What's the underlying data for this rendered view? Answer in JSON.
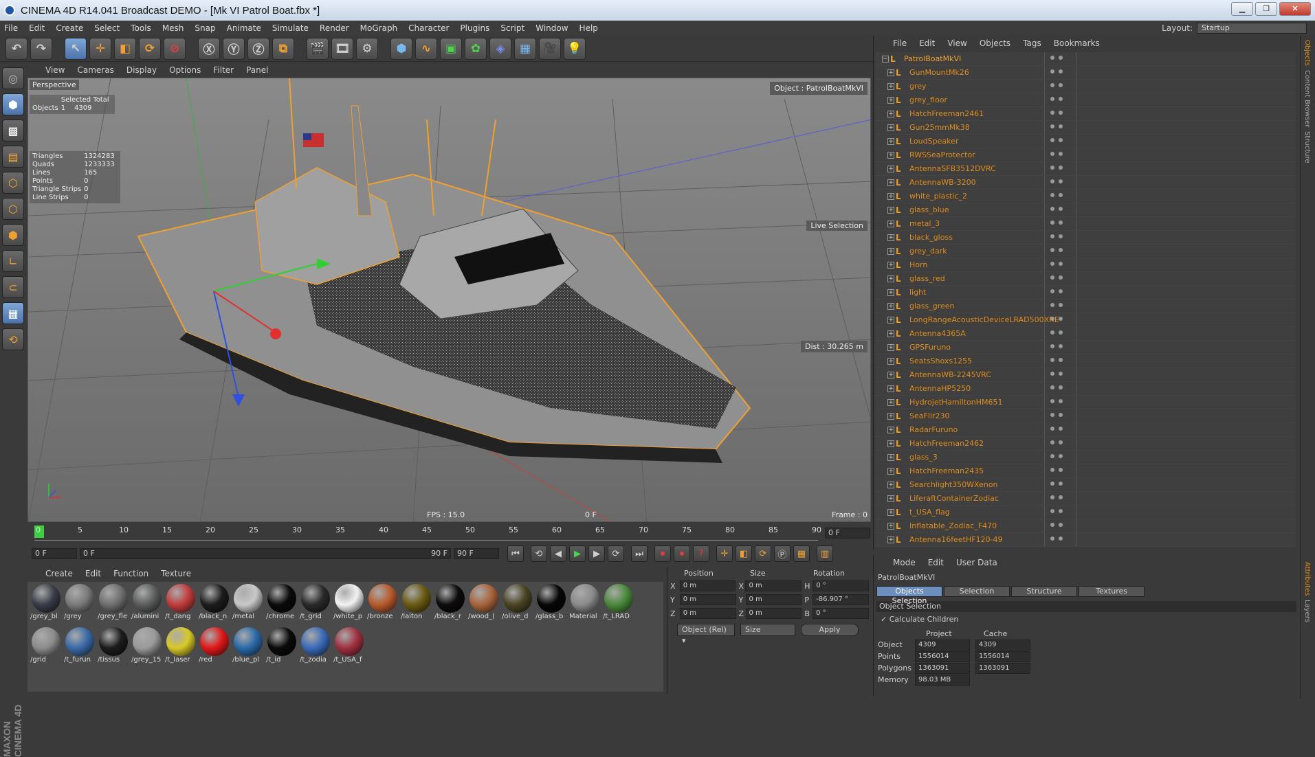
{
  "window": {
    "title": "CINEMA 4D R14.041 Broadcast DEMO - [Mk VI Patrol Boat.fbx *]",
    "min": "▁",
    "max": "❐",
    "close": "✕"
  },
  "menu": [
    "File",
    "Edit",
    "Create",
    "Select",
    "Tools",
    "Mesh",
    "Snap",
    "Animate",
    "Simulate",
    "Render",
    "MoGraph",
    "Character",
    "Plugins",
    "Script",
    "Window",
    "Help"
  ],
  "layout": {
    "label": "Layout:",
    "value": "Startup"
  },
  "viewport": {
    "menu": [
      "View",
      "Cameras",
      "Display",
      "Options",
      "Filter",
      "Panel"
    ],
    "label": "Perspective",
    "selected_header": "Selected Total",
    "objects_label": "Objects",
    "objects_sel": "1",
    "objects_total": "4309",
    "stats": [
      [
        "Triangles",
        "1324283"
      ],
      [
        "Quads",
        "1233333"
      ],
      [
        "Lines",
        "165"
      ],
      [
        "Points",
        "0"
      ],
      [
        "Triangle Strips",
        "0"
      ],
      [
        "Line Strips",
        "0"
      ]
    ],
    "object_label": "Object : PatrolBoatMkVI",
    "live_selection": "Live Selection",
    "dist": "Dist : 30.265 m",
    "fps": "FPS : 15.0",
    "frame_mid": "0 F",
    "frame_right": "Frame : 0"
  },
  "timeline": {
    "ticks": [
      "0",
      "5",
      "10",
      "15",
      "20",
      "25",
      "30",
      "35",
      "40",
      "45",
      "50",
      "55",
      "60",
      "65",
      "70",
      "75",
      "80",
      "85",
      "90"
    ],
    "current": "0 F"
  },
  "playbar": {
    "start": "0 F",
    "range_start": "0 F",
    "range_end": "90 F",
    "end": "90 F"
  },
  "materials": {
    "menu": [
      "Create",
      "Edit",
      "Function",
      "Texture"
    ],
    "items": [
      {
        "name": "/grey_bl",
        "color": "#3a3d48"
      },
      {
        "name": "/grey",
        "color": "#7a7a7a"
      },
      {
        "name": "/grey_fle",
        "color": "#6e6e6e"
      },
      {
        "name": "/alumini",
        "color": "#5b5e5c"
      },
      {
        "name": "/t_dang",
        "color": "#c23c3c"
      },
      {
        "name": "/black_n",
        "color": "#1c1c1c"
      },
      {
        "name": "/metal",
        "color": "#c8c8c8"
      },
      {
        "name": "/chrome",
        "color": "#0a0a0a"
      },
      {
        "name": "/t_grid",
        "color": "#2a2a2a"
      },
      {
        "name": "/white_p",
        "color": "#f2f2f2"
      },
      {
        "name": "/bronze",
        "color": "#b85a2c"
      },
      {
        "name": "/laiton",
        "color": "#6a5a12"
      },
      {
        "name": "/black_r",
        "color": "#0c0c0c"
      },
      {
        "name": "/wood_(",
        "color": "#a8643a"
      },
      {
        "name": "/olive_d",
        "color": "#4a4424"
      },
      {
        "name": "/glass_b",
        "color": "#060606"
      },
      {
        "name": "Material",
        "color": "#8a8a8a"
      },
      {
        "name": "/t_LRAD",
        "color": "#4a8a3a"
      },
      {
        "name": "/grid",
        "color": "#8c8c8c"
      },
      {
        "name": "/t_furun",
        "color": "#3a6aa8"
      },
      {
        "name": "/tissus",
        "color": "#1c1c1c"
      },
      {
        "name": "/grey_15",
        "color": "#9a9a9a"
      },
      {
        "name": "/t_laser",
        "color": "#d8c828"
      },
      {
        "name": "/red",
        "color": "#e01818"
      },
      {
        "name": "/blue_pl",
        "color": "#2a6aa8"
      },
      {
        "name": "/t_id",
        "color": "#0a0a0a"
      },
      {
        "name": "/t_zodia",
        "color": "#3a6ab8"
      },
      {
        "name": "/t_USA_f",
        "color": "#a03040"
      }
    ]
  },
  "coords": {
    "headers": [
      "Position",
      "Size",
      "Rotation"
    ],
    "rows": [
      [
        "X",
        "0 m",
        "X",
        "0 m",
        "H",
        "0 °"
      ],
      [
        "Y",
        "0 m",
        "Y",
        "0 m",
        "P",
        "-86.907 °"
      ],
      [
        "Z",
        "0 m",
        "Z",
        "0 m",
        "B",
        "0 °"
      ]
    ],
    "mode": "Object (Rel) ▾",
    "size": "Size",
    "apply": "Apply"
  },
  "objects": {
    "menu": [
      "File",
      "Edit",
      "View",
      "Objects",
      "Tags",
      "Bookmarks"
    ],
    "root": "PatrolBoatMkVI",
    "items": [
      "GunMountMk26",
      "grey",
      "grey_floor",
      "HatchFreeman2461",
      "Gun25mmMk38",
      "LoudSpeaker",
      "RWSSeaProtector",
      "AntennaSFB3512DVRC",
      "AntennaWB-3200",
      "white_plastic_2",
      "glass_blue",
      "metal_3",
      "black_gloss",
      "grey_dark",
      "Horn",
      "glass_red",
      "light",
      "glass_green",
      "LongRangeAcousticDeviceLRAD500XRE",
      "Antenna4365A",
      "GPSFuruno",
      "SeatsShoxs1255",
      "AntennaWB-2245VRC",
      "AntennaHP5250",
      "HydrojetHamiltonHM651",
      "SeaFlir230",
      "RadarFuruno",
      "HatchFreeman2462",
      "glass_3",
      "HatchFreeman2435",
      "Searchlight350WXenon",
      "LiferaftContainerZodiac",
      "t_USA_flag",
      "Inflatable_Zodiac_F470",
      "Antenna16feetHF120-49"
    ]
  },
  "attributes": {
    "menu": [
      "Mode",
      "Edit",
      "User Data"
    ],
    "object_name": "PatrolBoatMkVI",
    "tabs": [
      "Objects Selection",
      "Selection",
      "Structure",
      "Textures"
    ],
    "section": "Object Selection",
    "calc_children": "✓ Calculate Children",
    "col_project": "Project",
    "col_cache": "Cache",
    "rows": [
      [
        "Object",
        "4309",
        "4309"
      ],
      [
        "Points",
        "1556014",
        "1556014"
      ],
      [
        "Polygons",
        "1363091",
        "1363091"
      ],
      [
        "Memory",
        "98.03 MB",
        ""
      ]
    ]
  },
  "side_tabs": [
    "Objects",
    "Content Browser",
    "Structure"
  ],
  "attr_side_tabs": [
    "Attributes",
    "Layers"
  ],
  "brand": "MAXON CINEMA 4D"
}
